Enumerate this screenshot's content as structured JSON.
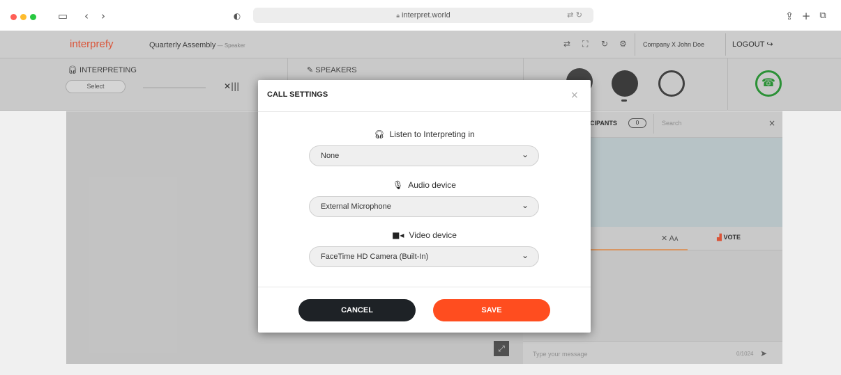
{
  "browser": {
    "url": "interpret.world",
    "window_icons": {
      "sidebar": "sidebar-icon",
      "back": "chevron-left-icon",
      "forward": "chevron-right-icon",
      "shield": "shield-icon",
      "share": "share-icon",
      "new_tab": "plus-icon",
      "tabs": "tabs-icon",
      "translate": "translate-icon",
      "reload": "reload-icon"
    }
  },
  "app": {
    "brand": "interprefy",
    "meeting_title": "Quarterly Assembly",
    "meeting_role": " — Speaker",
    "user": "Company X John Doe",
    "logout": "LOGOUT",
    "colors": {
      "brand": "#e85a3c",
      "accent": "#ff4d1f",
      "dark": "#1e2226",
      "call_green": "#2e9b3a"
    }
  },
  "toolbar": {
    "interpreting_label": "INTERPRETING",
    "select_label": "Select",
    "speakers_label": "SPEAKERS"
  },
  "panel": {
    "participants_label": "CIPANTS",
    "search_placeholder": "Search",
    "font_size_label": "Aᴀ",
    "vote_label": "VOTE",
    "chat_placeholder": "Type your message",
    "char_count": "0/1024"
  },
  "modal": {
    "title": "CALL SETTINGS",
    "interpreting": {
      "label": "Listen to Interpreting in",
      "value": "None"
    },
    "audio": {
      "label": "Audio device",
      "value": "External Microphone"
    },
    "video": {
      "label": "Video device",
      "value": "FaceTime HD Camera (Built-In)"
    },
    "cancel_label": "CANCEL",
    "save_label": "SAVE"
  }
}
